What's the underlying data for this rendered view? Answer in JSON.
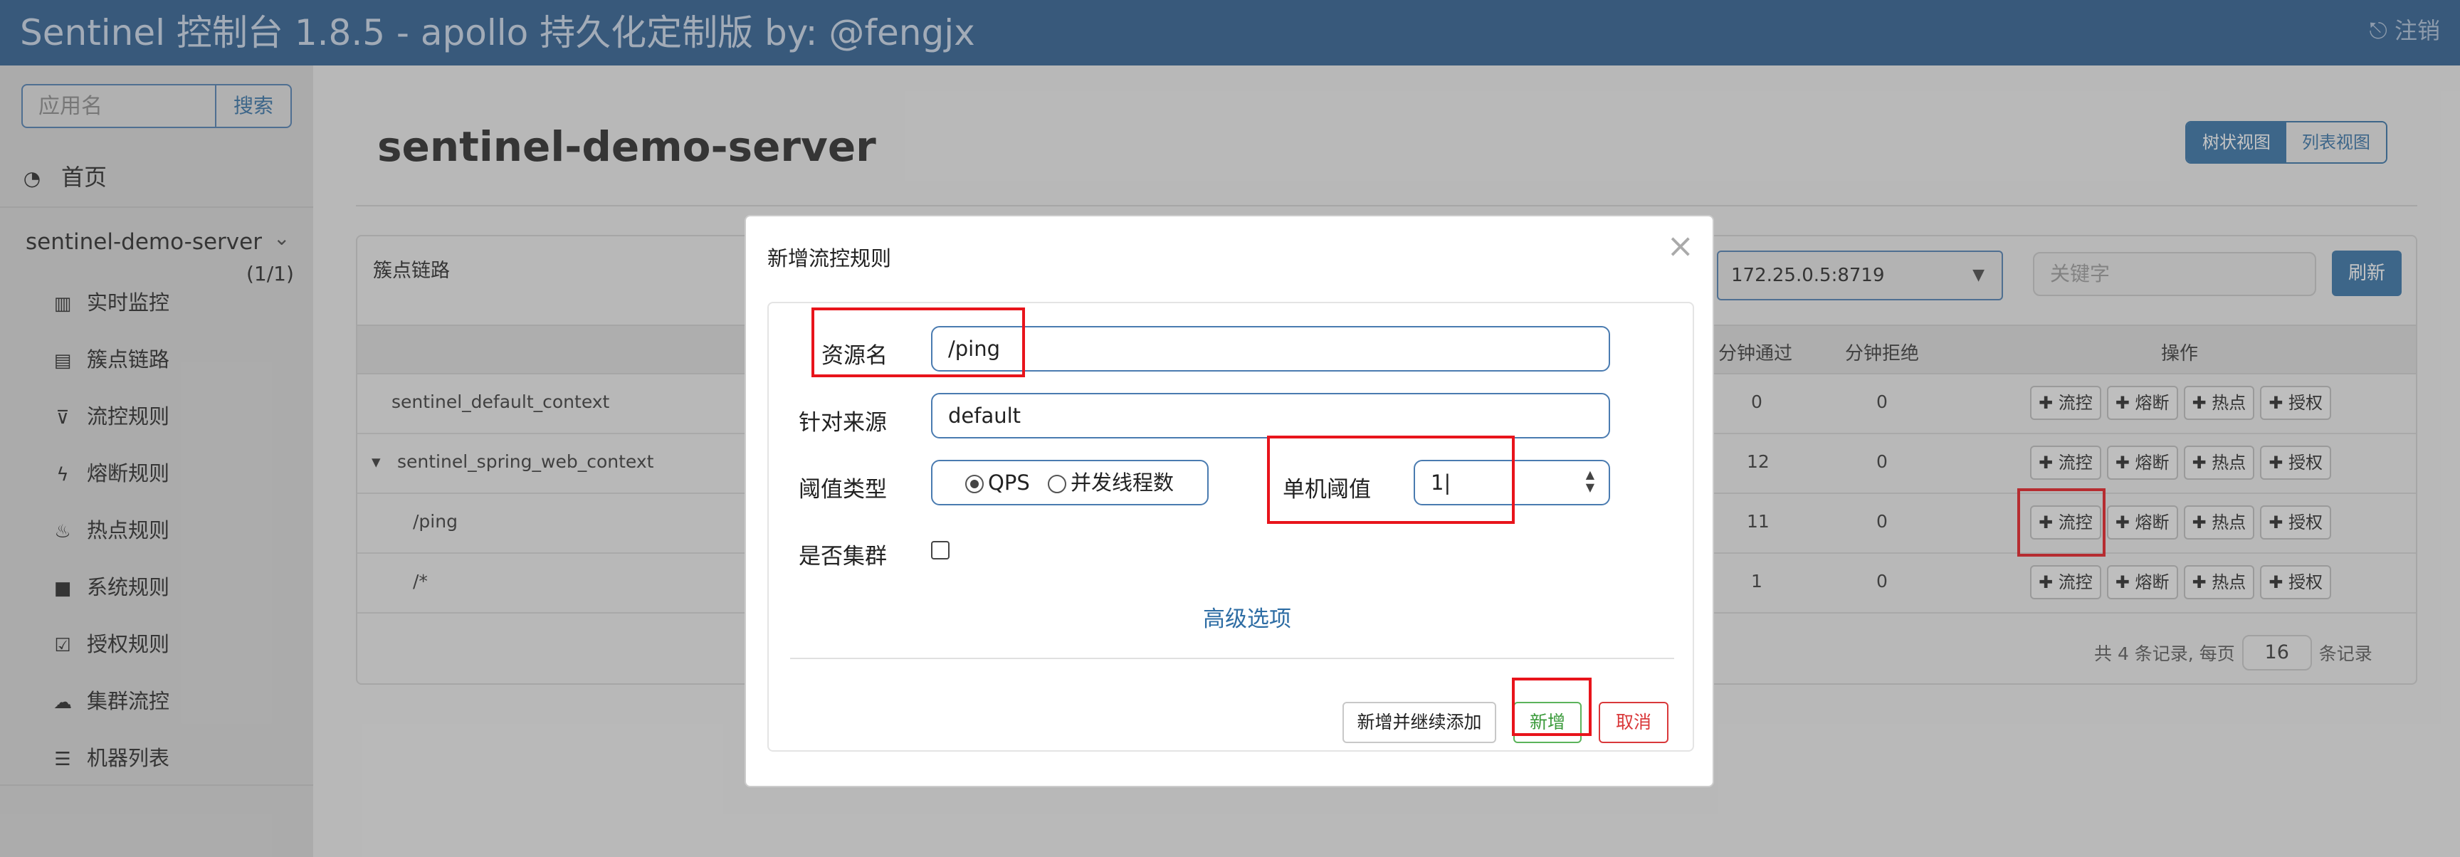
{
  "header": {
    "title": "Sentinel 控制台 1.8.5 - apollo 持久化定制版 by: @fengjx",
    "logout": "注销"
  },
  "sidebar": {
    "search_placeholder": "应用名",
    "search_button": "搜索",
    "home": "首页",
    "app": {
      "name": "sentinel-demo-server",
      "count": "(1/1)"
    },
    "items": [
      {
        "label": "实时监控",
        "icon": "bar-chart-icon"
      },
      {
        "label": "簇点链路",
        "icon": "list-icon"
      },
      {
        "label": "流控规则",
        "icon": "filter-icon"
      },
      {
        "label": "熔断规则",
        "icon": "flash-icon"
      },
      {
        "label": "热点规则",
        "icon": "fire-icon"
      },
      {
        "label": "系统规则",
        "icon": "lock-icon"
      },
      {
        "label": "授权规则",
        "icon": "check-square-icon"
      },
      {
        "label": "集群流控",
        "icon": "cloud-icon"
      },
      {
        "label": "机器列表",
        "icon": "list-ul-icon"
      }
    ]
  },
  "main": {
    "page_title": "sentinel-demo-server",
    "view_buttons": [
      "树状视图",
      "列表视图"
    ],
    "panel_title": "簇点链路",
    "machine": "172.25.0.5:8719",
    "keyword_placeholder": "关键字",
    "refresh": "刷新",
    "columns": {
      "pass": "分钟通过",
      "block": "分钟拒绝",
      "ops": "操作"
    },
    "rows": [
      {
        "name": "sentinel_default_context",
        "pass": "0",
        "block": "0"
      },
      {
        "name": "sentinel_spring_web_context",
        "pass": "12",
        "block": "0"
      },
      {
        "name": "/ping",
        "pass": "11",
        "block": "0"
      },
      {
        "name": "/*",
        "pass": "1",
        "block": "0"
      }
    ],
    "op_buttons": [
      "流控",
      "熔断",
      "热点",
      "授权"
    ],
    "pager": {
      "prefix": "共 4 条记录, 每页",
      "size": "16",
      "suffix": "条记录"
    }
  },
  "modal": {
    "title": "新增流控规则",
    "resource_label": "资源名",
    "resource_value": "/ping",
    "origin_label": "针对来源",
    "origin_value": "default",
    "grade_label": "阈值类型",
    "grade_qps": "QPS",
    "grade_thread": "并发线程数",
    "threshold_label": "单机阈值",
    "threshold_value": "1",
    "cluster_label": "是否集群",
    "advanced": "高级选项",
    "btn_add_continue": "新增并继续添加",
    "btn_add": "新增",
    "btn_cancel": "取消"
  },
  "colors": {
    "header": "#275a8e",
    "primary": "#2e6da4",
    "highlight": "#e8141b",
    "success": "#3a9a3a",
    "danger": "#d9383a"
  }
}
